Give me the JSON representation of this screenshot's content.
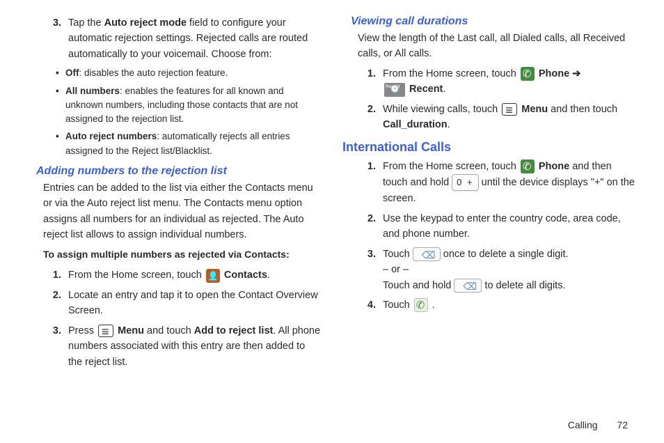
{
  "left": {
    "item3": {
      "num": "3.",
      "lead": "Tap the ",
      "b1": "Auto reject mode",
      "mid": " field to configure your automatic rejection settings. Rejected calls are routed automatically to your voicemail. Choose from:"
    },
    "bullets": {
      "a": {
        "b": "Off",
        "t": ": disables the auto rejection feature."
      },
      "b": {
        "b": "All numbers",
        "t": ": enables the features for all known and unknown numbers, including those contacts that are not assigned to the rejection list."
      },
      "c": {
        "b": "Auto reject numbers",
        "t": ": automatically rejects all entries assigned to the Reject list/Blacklist."
      }
    },
    "h_adding": "Adding numbers to the rejection list",
    "p_adding": "Entries can be added to the list via either the Contacts menu or via the Auto reject list menu. The Contacts menu option assigns all numbers for an individual as rejected. The Auto reject list allows to assign individual numbers.",
    "p_assign": "To assign multiple numbers as rejected via Contacts:",
    "s1": {
      "num": "1.",
      "t1": "From the Home screen, touch ",
      "b1": "Contacts",
      "t2": "."
    },
    "s2": {
      "num": "2.",
      "t": "Locate an entry and tap it to open the Contact Overview Screen."
    },
    "s3": {
      "num": "3.",
      "t1": "Press ",
      "b1": "Menu",
      "t2": " and touch ",
      "b2": "Add to reject list",
      "t3": ". All phone numbers associated with this entry are then added to the reject list."
    }
  },
  "right": {
    "h_view": "Viewing call durations",
    "p_view": "View the length of the Last call, all Dialed calls, all Received calls, or All calls.",
    "v1": {
      "num": "1.",
      "t1": "From the Home screen, touch ",
      "b1": "Phone",
      "arrow": " ➔",
      "b2": "Recent",
      "t2": "."
    },
    "v2": {
      "num": "2.",
      "t1": "While viewing calls, touch ",
      "b1": "Menu",
      "t2": " and then touch ",
      "b2": "Call_duration",
      "t3": "."
    },
    "h_intl": "International Calls",
    "i1": {
      "num": "1.",
      "t1": "From the Home screen, touch ",
      "b1": "Phone",
      "t2": " and then touch and hold ",
      "key": "0 +",
      "t3": " until the device displays \"+\" on the screen."
    },
    "i2": {
      "num": "2.",
      "t": "Use the keypad to enter the country code, area code, and phone number."
    },
    "i3": {
      "num": "3.",
      "t1": "Touch ",
      "t2": " once to delete a single digit.",
      "or": "– or –",
      "t3": "Touch and hold ",
      "t4": " to delete all digits."
    },
    "i4": {
      "num": "4.",
      "t1": "Touch ",
      "t2": "."
    }
  },
  "footer": {
    "section": "Calling",
    "page": "72"
  }
}
